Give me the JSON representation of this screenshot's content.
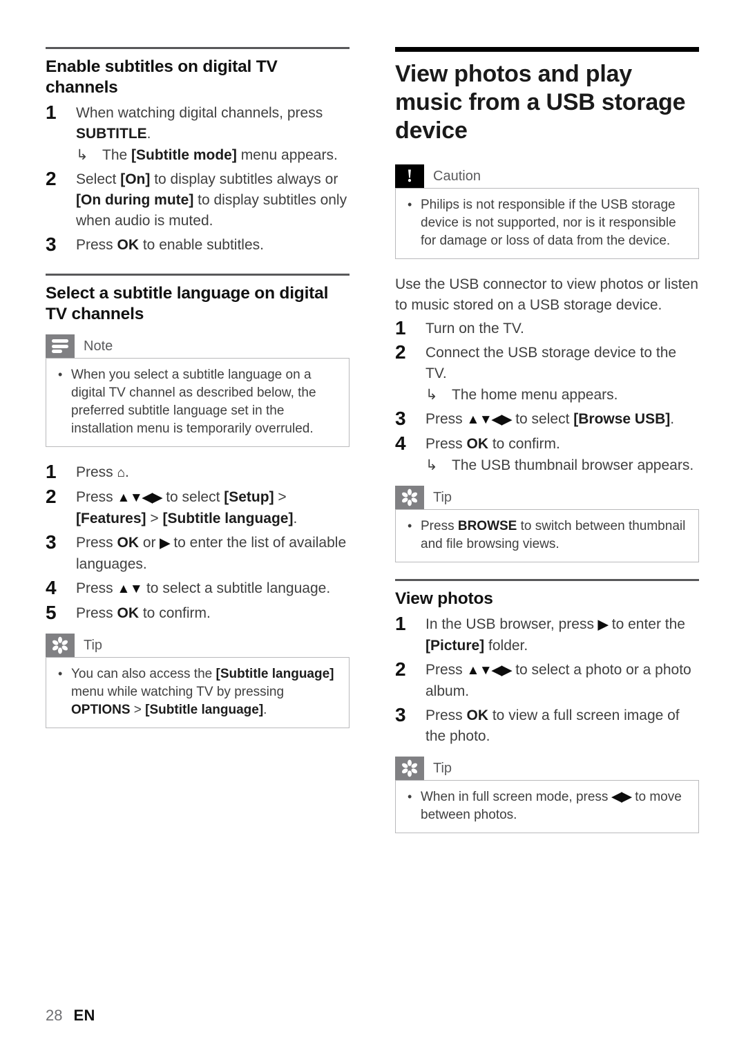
{
  "page": {
    "number": "28",
    "language": "EN"
  },
  "left_column": {
    "section1": {
      "heading": "Enable subtitles on digital TV channels",
      "steps": [
        {
          "num": "1",
          "text_parts": [
            {
              "t": "When watching digital channels, press ",
              "bold": false
            },
            {
              "t": "SUBTITLE",
              "bold": true
            },
            {
              "t": ".",
              "bold": false
            }
          ],
          "result_parts": [
            {
              "t": "The ",
              "bold": false
            },
            {
              "t": "[Subtitle mode]",
              "bold": true
            },
            {
              "t": " menu appears.",
              "bold": false
            }
          ]
        },
        {
          "num": "2",
          "text_parts": [
            {
              "t": "Select ",
              "bold": false
            },
            {
              "t": "[On]",
              "bold": true
            },
            {
              "t": " to display subtitles always or ",
              "bold": false
            },
            {
              "t": "[On during mute]",
              "bold": true
            },
            {
              "t": " to display subtitles only when audio is muted.",
              "bold": false
            }
          ]
        },
        {
          "num": "3",
          "text_parts": [
            {
              "t": "Press ",
              "bold": false
            },
            {
              "t": "OK",
              "bold": true
            },
            {
              "t": " to enable subtitles.",
              "bold": false
            }
          ]
        }
      ]
    },
    "section2": {
      "heading": "Select a subtitle language on digital TV channels",
      "note": {
        "icon": "note-lines-icon",
        "label": "Note",
        "bullets": [
          "When you select a subtitle language on a digital TV channel as described below, the preferred subtitle language set in the installation menu is temporarily overruled."
        ]
      },
      "steps": [
        {
          "num": "1",
          "text_parts": [
            {
              "t": "Press ",
              "bold": false
            },
            {
              "t": "⌂HOME",
              "bold": false,
              "icon": "home-icon"
            },
            {
              "t": ".",
              "bold": false
            }
          ]
        },
        {
          "num": "2",
          "text_parts": [
            {
              "t": "Press ",
              "bold": false
            },
            {
              "t": "▲▼◀▶",
              "bold": true,
              "nav": true
            },
            {
              "t": " to select ",
              "bold": false
            },
            {
              "t": "[Setup]",
              "bold": true
            },
            {
              "t": " > ",
              "bold": false
            },
            {
              "t": "[Features]",
              "bold": true
            },
            {
              "t": " > ",
              "bold": false
            },
            {
              "t": "[Subtitle language]",
              "bold": true
            },
            {
              "t": ".",
              "bold": false
            }
          ]
        },
        {
          "num": "3",
          "text_parts": [
            {
              "t": "Press ",
              "bold": false
            },
            {
              "t": "OK",
              "bold": true
            },
            {
              "t": " or ",
              "bold": false
            },
            {
              "t": "▶",
              "bold": true,
              "nav": true
            },
            {
              "t": " to enter the list of available languages.",
              "bold": false
            }
          ]
        },
        {
          "num": "4",
          "text_parts": [
            {
              "t": "Press ",
              "bold": false
            },
            {
              "t": "▲▼",
              "bold": true,
              "nav": true
            },
            {
              "t": " to select a subtitle language.",
              "bold": false
            }
          ]
        },
        {
          "num": "5",
          "text_parts": [
            {
              "t": "Press ",
              "bold": false
            },
            {
              "t": "OK",
              "bold": true
            },
            {
              "t": " to confirm.",
              "bold": false
            }
          ]
        }
      ],
      "tip": {
        "icon": "tip-asterisk-icon",
        "label": "Tip",
        "bullet_parts": [
          {
            "t": "You can also access the ",
            "bold": false
          },
          {
            "t": "[Subtitle language]",
            "bold": true
          },
          {
            "t": " menu while watching TV by pressing ",
            "bold": false
          },
          {
            "t": "OPTIONS",
            "bold": true
          },
          {
            "t": " > ",
            "bold": false
          },
          {
            "t": "[Subtitle language]",
            "bold": true
          },
          {
            "t": ".",
            "bold": false
          }
        ]
      }
    }
  },
  "right_column": {
    "title": "View photos and play music from a USB storage device",
    "caution": {
      "icon": "exclamation-icon",
      "label": "Caution",
      "bullets": [
        "Philips is not responsible if the USB storage device is not supported, nor is it responsible for damage or loss of data from the device."
      ]
    },
    "intro": "Use the USB connector to view photos or listen to music stored on a USB storage device.",
    "steps": [
      {
        "num": "1",
        "text_parts": [
          {
            "t": "Turn on the TV.",
            "bold": false
          }
        ]
      },
      {
        "num": "2",
        "text_parts": [
          {
            "t": "Connect the USB storage device to the TV.",
            "bold": false
          }
        ],
        "result_parts": [
          {
            "t": "The home menu appears.",
            "bold": false
          }
        ]
      },
      {
        "num": "3",
        "text_parts": [
          {
            "t": "Press ",
            "bold": false
          },
          {
            "t": "▲▼◀▶",
            "bold": true,
            "nav": true
          },
          {
            "t": " to select ",
            "bold": false
          },
          {
            "t": "[Browse USB]",
            "bold": true
          },
          {
            "t": ".",
            "bold": false
          }
        ]
      },
      {
        "num": "4",
        "text_parts": [
          {
            "t": "Press ",
            "bold": false
          },
          {
            "t": "OK",
            "bold": true
          },
          {
            "t": " to confirm.",
            "bold": false
          }
        ],
        "result_parts": [
          {
            "t": "The USB thumbnail browser appears.",
            "bold": false
          }
        ]
      }
    ],
    "tip1": {
      "icon": "tip-asterisk-icon",
      "label": "Tip",
      "bullet_parts": [
        {
          "t": "Press ",
          "bold": false
        },
        {
          "t": "BROWSE",
          "bold": true
        },
        {
          "t": " to switch between thumbnail and file browsing views.",
          "bold": false
        }
      ]
    },
    "section_view_photos": {
      "heading": "View photos",
      "steps": [
        {
          "num": "1",
          "text_parts": [
            {
              "t": "In the USB browser, press ",
              "bold": false
            },
            {
              "t": "▶",
              "bold": true,
              "nav": true
            },
            {
              "t": " to enter the ",
              "bold": false
            },
            {
              "t": "[Picture]",
              "bold": true
            },
            {
              "t": " folder.",
              "bold": false
            }
          ]
        },
        {
          "num": "2",
          "text_parts": [
            {
              "t": "Press ",
              "bold": false
            },
            {
              "t": "▲▼◀▶",
              "bold": true,
              "nav": true
            },
            {
              "t": " to select a photo or a photo album.",
              "bold": false
            }
          ]
        },
        {
          "num": "3",
          "text_parts": [
            {
              "t": "Press ",
              "bold": false
            },
            {
              "t": "OK",
              "bold": true
            },
            {
              "t": " to view a full screen image of the photo.",
              "bold": false
            }
          ]
        }
      ]
    },
    "tip2": {
      "icon": "tip-asterisk-icon",
      "label": "Tip",
      "bullet_parts": [
        {
          "t": "When in full screen mode, press ",
          "bold": false
        },
        {
          "t": "◀▶",
          "bold": true,
          "nav": true
        },
        {
          "t": " to move between photos.",
          "bold": false
        }
      ]
    }
  },
  "colors": {
    "tab_gray": "#808083",
    "tab_black": "#000000",
    "rule_gray": "#58585a",
    "rule_black": "#000000",
    "body_text": "#3f3f3f",
    "label_text": "#5a5a5c"
  }
}
